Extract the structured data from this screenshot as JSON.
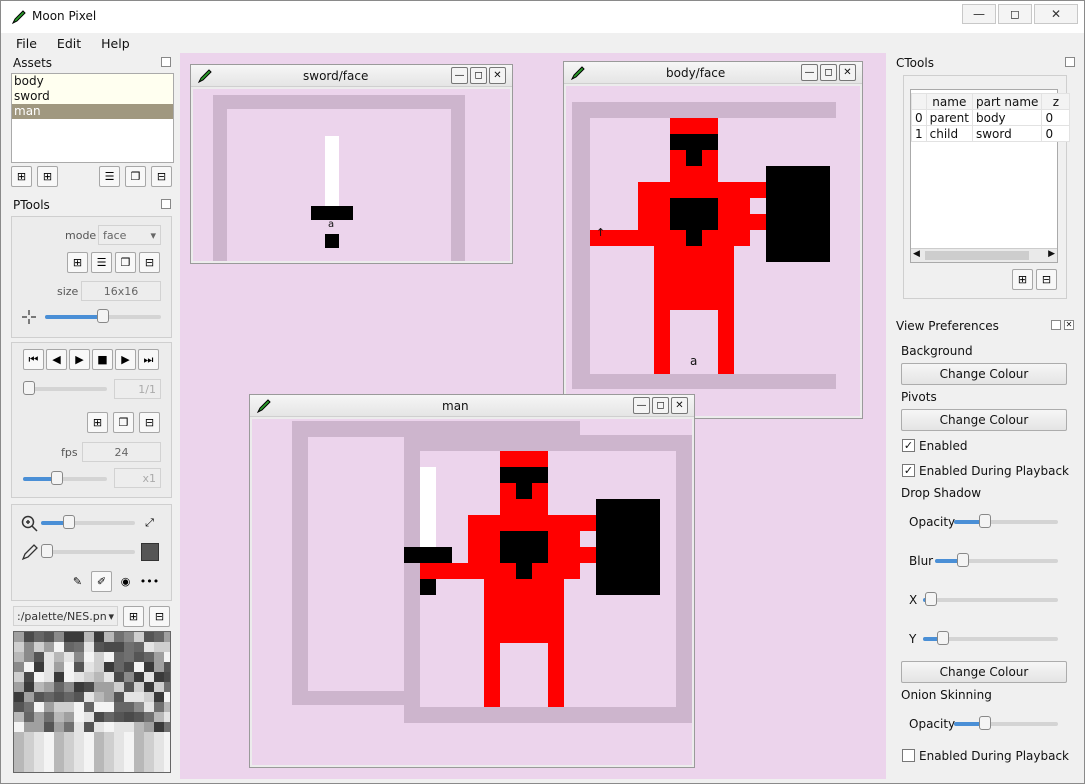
{
  "app": {
    "title": "Moon Pixel"
  },
  "window_buttons": [
    "—",
    "◻",
    "✕"
  ],
  "menu": [
    "File",
    "Edit",
    "Help"
  ],
  "assets": {
    "title": "Assets",
    "items": [
      {
        "label": "body"
      },
      {
        "label": "sword"
      },
      {
        "label": "man"
      }
    ],
    "selected": 2
  },
  "ptools": {
    "title": "PTools",
    "mode_label": "mode",
    "mode_value": "face",
    "size_label": "size",
    "size_value": "16x16",
    "frame_value": "1/1",
    "fps_label": "fps",
    "fps_value": "24",
    "scale_value": "x1",
    "pivot_level": 0.5,
    "frame_level": 0.0,
    "fps_level": 0.4,
    "zoom_level": 0.3,
    "brush_level": 0.0,
    "palette_path": ":/palette/NES.pn"
  },
  "subwindows": {
    "sword_face": {
      "title": "sword/face",
      "label_a": "a"
    },
    "body_face": {
      "title": "body/face",
      "label_a": "a",
      "label_arrow": "↑"
    },
    "man": {
      "title": "man"
    }
  },
  "ctools": {
    "title": "CTools",
    "columns": [
      "name",
      "part name",
      "z"
    ],
    "rows": [
      {
        "index": "0",
        "name": "parent",
        "part": "body",
        "z": "0"
      },
      {
        "index": "1",
        "name": "child",
        "part": "sword",
        "z": "0"
      }
    ]
  },
  "view_prefs": {
    "title": "View Preferences",
    "background": "Background",
    "change_colour": "Change Colour",
    "pivots": "Pivots",
    "enabled": "Enabled",
    "enabled_playback": "Enabled During Playback",
    "drop_shadow": "Drop Shadow",
    "opacity": "Opacity",
    "blur": "Blur",
    "x": "X",
    "y": "Y",
    "onion": "Onion Skinning",
    "shadow_opacity_level": 0.3,
    "blur_level": 0.23,
    "x_level": 0.06,
    "y_level": 0.15,
    "onion_opacity_level": 0.3,
    "pivots_enabled": true,
    "pivots_enabled_playback": true,
    "onion_enabled_playback": false
  },
  "colors": {
    "mdi_bg": "#ecd4ec",
    "sprite_red": "#ff0000",
    "sprite_black": "#000000",
    "frame": "#cdb5cd"
  }
}
